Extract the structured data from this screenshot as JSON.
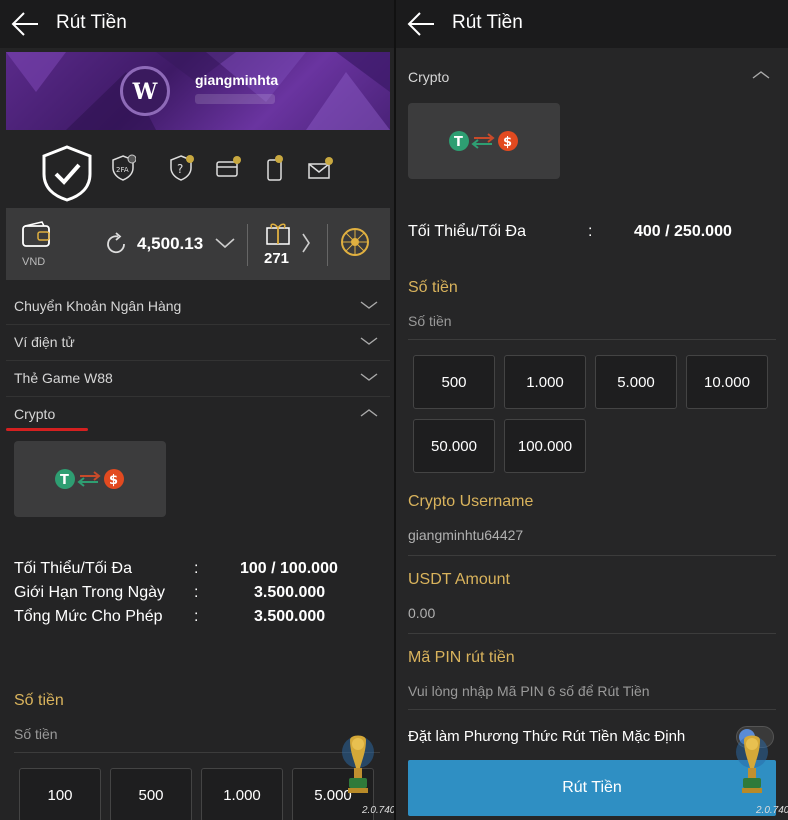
{
  "left": {
    "header": {
      "title": "Rút Tiền"
    },
    "profile": {
      "username": "giangminhta"
    },
    "wallet": {
      "currency": "VND",
      "balance": "4,500.13",
      "gift_count": "271"
    },
    "methods": [
      {
        "label": "Chuyển Khoản Ngân Hàng",
        "expanded": false
      },
      {
        "label": "Ví điện tử",
        "expanded": false
      },
      {
        "label": "Thẻ Game W88",
        "expanded": false
      },
      {
        "label": "Crypto",
        "expanded": true
      }
    ],
    "limits": [
      {
        "key": "Tối Thiểu/Tối Đa",
        "value": "100 / 100.000"
      },
      {
        "key": "Giới Hạn Trong Ngày",
        "value": "3.500.000"
      },
      {
        "key": "Tổng Mức Cho Phép",
        "value": "3.500.000"
      }
    ],
    "amount": {
      "label": "Số tiền",
      "placeholder": "Số tiền"
    },
    "quick_amounts": [
      "100",
      "500",
      "1.000",
      "5.000"
    ],
    "version": "2.0.740"
  },
  "right": {
    "header": {
      "title": "Rút Tiền"
    },
    "section": "Crypto",
    "limit": {
      "key": "Tối Thiểu/Tối Đa",
      "value": "400 / 250.000"
    },
    "amount": {
      "label": "Số tiền",
      "placeholder": "Số tiền"
    },
    "quick_amounts": [
      "500",
      "1.000",
      "5.000",
      "10.000",
      "50.000",
      "100.000"
    ],
    "crypto_username": {
      "label": "Crypto Username",
      "value": "giangminhtu64427"
    },
    "usdt_amount": {
      "label": "USDT Amount",
      "value": "0.00"
    },
    "pin": {
      "label": "Mã PIN rút tiền",
      "placeholder": "Vui lòng nhập Mã PIN 6 số để Rút Tiền"
    },
    "default_method": {
      "label": "Đặt làm Phương Thức Rút Tiền Mặc Định"
    },
    "submit_label": "Rút Tiền",
    "version": "2.0.740"
  },
  "colors": {
    "accent_gold": "#d9b35c",
    "submit_blue": "#2f8fc3",
    "highlight_red": "#d42020"
  }
}
